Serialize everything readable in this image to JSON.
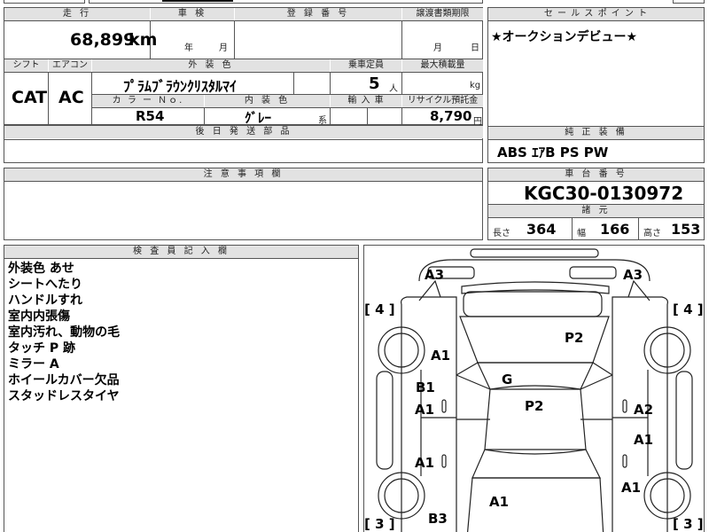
{
  "top_strip": {
    "text": ""
  },
  "vehicle": {
    "mileage_header": "走 行",
    "mileage": "68,899",
    "mileage_unit": "km",
    "inspection_header": "車 検",
    "inspection_year_label": "年",
    "inspection_month_label": "月",
    "registration_header": "登 録 番 号",
    "transfer_header": "譲渡書類期限",
    "transfer_month_label": "月",
    "transfer_day_label": "日",
    "shift_header": "シフト",
    "shift": "CAT",
    "ac_header": "エアコン",
    "ac": "AC",
    "exterior_header": "外 装 色",
    "exterior_color": "ﾌﾟﾗﾑﾌﾞﾗｳﾝｸﾘｽﾀﾙﾏｲ",
    "capacity_header": "乗車定員",
    "capacity": "5",
    "capacity_unit": "人",
    "max_load_header": "最大積載量",
    "max_load_unit": "kg",
    "color_no_header": "カ ラ ー Ｎｏ.",
    "color_no": "R54",
    "interior_header": "内 装 色",
    "interior_color": "ｸﾞﾚｰ",
    "interior_suffix": "系",
    "import_header": "輸 入 車",
    "recycle_header": "リサイクル預託金",
    "recycle_fee": "8,790",
    "recycle_unit": "円",
    "parts_header": "後 日 発 送 部 品"
  },
  "sales_point": {
    "header": "セ ー ル ス ポ イ ン ト",
    "text": "★オークションデビュー★"
  },
  "equipment": {
    "header": "純 正 装 備",
    "items": "ABS ｴｱB PS PW"
  },
  "caution": {
    "header": "注 意 事 項 欄"
  },
  "chassis": {
    "header": "車 台 番 号",
    "number": "KGC30-0130972",
    "spec_header": "諸 元",
    "length_label": "長さ",
    "length": "364",
    "width_label": "幅",
    "width": "166",
    "height_label": "高さ",
    "height": "153"
  },
  "inspector": {
    "header": "検 査 員 記 入 欄",
    "notes": [
      "外装色 あせ",
      "シートへたり",
      "ハンドルすれ",
      "室内内張傷",
      "室内汚れ、動物の毛",
      "タッチ P 跡",
      "ミラー A",
      "ホイールカバー欠品",
      "スタッドレスタイヤ"
    ]
  },
  "diagram": {
    "marks": {
      "a3_left": "A3",
      "a3_right": "A3",
      "tire_lf": "[ 4 ]",
      "tire_rf": "[ 4 ]",
      "p2_hood": "P2",
      "a1_front_left": "A1",
      "g_windshield": "G",
      "b1_left": "B1",
      "a1_left_mid": "A1",
      "p2_roof": "P2",
      "a2_right": "A2",
      "a1_right_mid": "A1",
      "a1_left_lower": "A1",
      "a1_right_lower": "A1",
      "a1_rear": "A1",
      "b3_rear": "B3",
      "tire_lr": "[ 3 ]",
      "tire_rr": "[ 3 ]"
    }
  }
}
